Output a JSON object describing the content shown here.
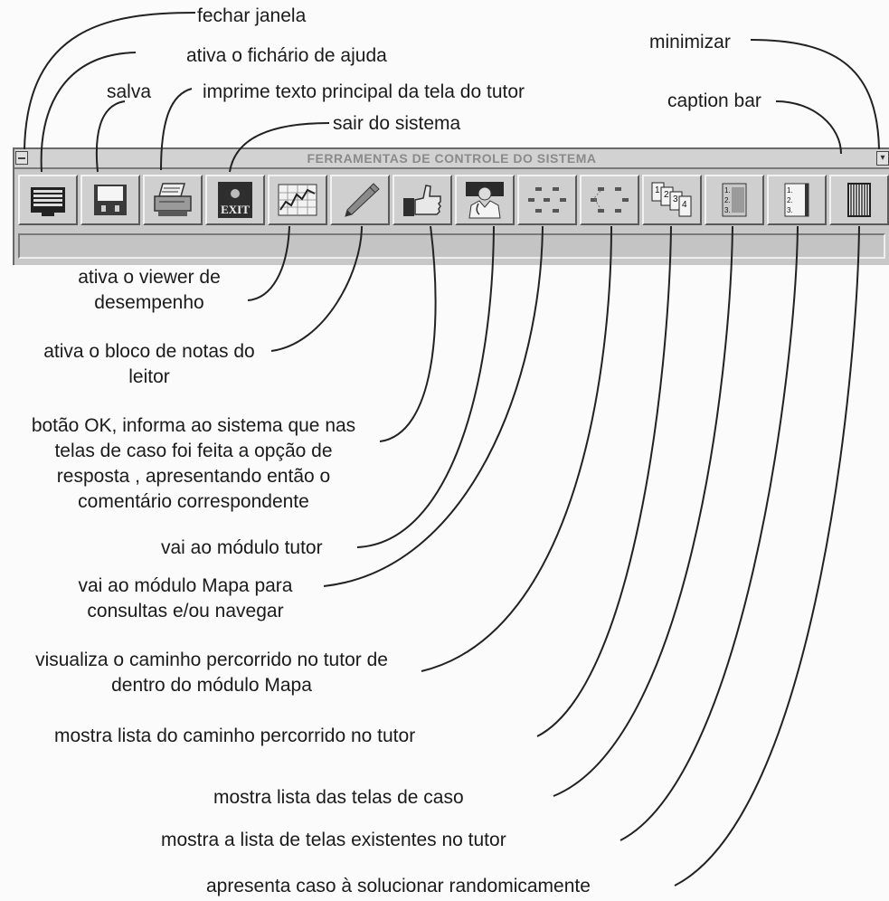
{
  "window": {
    "title": "FERRAMENTAS DE CONTROLE DO SISTEMA",
    "minimize_glyph": "▾",
    "buttons": [
      {
        "name": "help-notebook-button",
        "icon": "notebook-icon"
      },
      {
        "name": "save-button",
        "icon": "floppy-disk-icon"
      },
      {
        "name": "print-button",
        "icon": "printer-icon"
      },
      {
        "name": "exit-button",
        "icon": "exit-icon",
        "text": "EXIT"
      },
      {
        "name": "performance-viewer-button",
        "icon": "chart-icon"
      },
      {
        "name": "notepad-button",
        "icon": "pencil-icon"
      },
      {
        "name": "ok-button",
        "icon": "thumbs-up-icon"
      },
      {
        "name": "tutor-module-button",
        "icon": "doctor-icon"
      },
      {
        "name": "map-module-button",
        "icon": "map-icon"
      },
      {
        "name": "map-path-button",
        "icon": "map-path-icon"
      },
      {
        "name": "tutor-path-list-button",
        "icon": "cards-icon",
        "cards": [
          "1",
          "2",
          "3",
          "4"
        ]
      },
      {
        "name": "case-screens-list-button",
        "icon": "numbered-list-icon",
        "numbers": [
          "1.",
          "2.",
          "3."
        ]
      },
      {
        "name": "tutor-screens-list-button",
        "icon": "numbered-page-icon",
        "numbers": [
          "1.",
          "2.",
          "3."
        ]
      },
      {
        "name": "random-case-button",
        "icon": "striped-page-icon"
      }
    ]
  },
  "annotations": {
    "fechar_janela": "fechar janela",
    "ficha_ajuda": "ativa o fichário de ajuda",
    "salva": "salva",
    "imprime": "imprime texto principal da tela do tutor",
    "sair": "sair do sistema",
    "minimizar": "minimizar",
    "caption_bar": "caption bar",
    "viewer_1": "ativa o viewer de",
    "viewer_2": "desempenho",
    "bloco_1": "ativa o bloco de notas do",
    "bloco_2": "leitor",
    "ok_1": "botão OK, informa ao sistema que nas",
    "ok_2": "telas de caso foi feita a opção de",
    "ok_3": "resposta , apresentando então o",
    "ok_4": "comentário correspondente",
    "tutor": "vai ao módulo tutor",
    "mapa_1": "vai ao módulo Mapa para",
    "mapa_2": "consultas e/ou navegar",
    "caminho_1": "visualiza o caminho percorrido no tutor de",
    "caminho_2": "dentro do módulo Mapa",
    "lista_caminho": "mostra lista do caminho percorrido no tutor",
    "lista_caso": "mostra lista das telas de caso",
    "lista_telas": "mostra a lista de telas existentes no tutor",
    "randomico": "apresenta caso à solucionar randomicamente"
  }
}
